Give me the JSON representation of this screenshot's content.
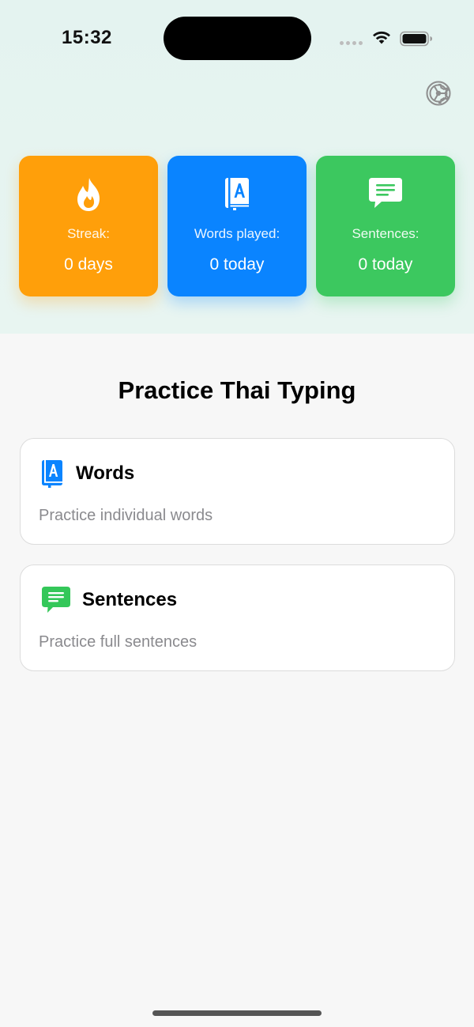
{
  "status_bar": {
    "time": "15:32"
  },
  "settings": {
    "icon": "gear-icon"
  },
  "stats": [
    {
      "icon": "flame-icon",
      "label": "Streak:",
      "value": "0 days",
      "color": "#ff9f0a"
    },
    {
      "icon": "book-icon",
      "label": "Words played:",
      "value": "0 today",
      "color": "#0a84ff"
    },
    {
      "icon": "message-icon",
      "label": "Sentences:",
      "value": "0 today",
      "color": "#34c759"
    }
  ],
  "main": {
    "title": "Practice Thai Typing",
    "options": [
      {
        "icon": "book-icon",
        "title": "Words",
        "description": "Practice individual words",
        "color": "#0a84ff"
      },
      {
        "icon": "message-icon",
        "title": "Sentences",
        "description": "Practice full sentences",
        "color": "#34c759"
      }
    ]
  }
}
